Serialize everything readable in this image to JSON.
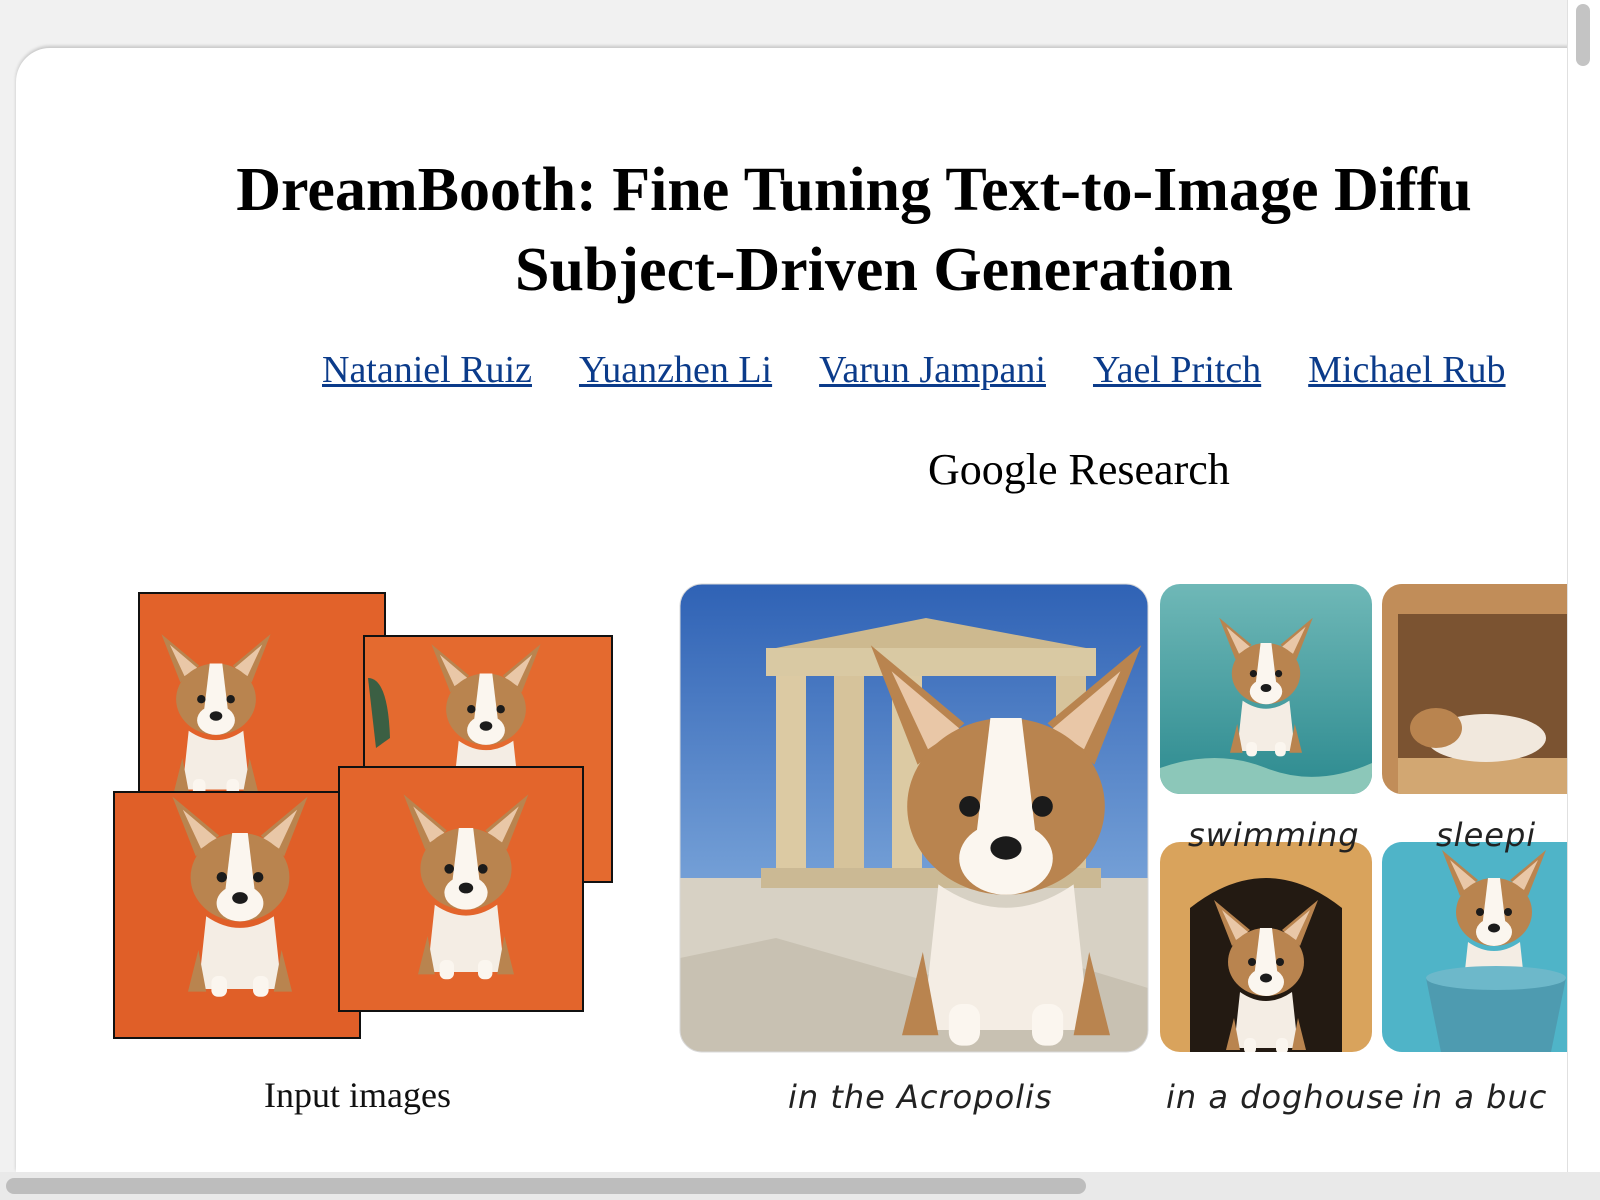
{
  "paper": {
    "title_line1": "DreamBooth: Fine Tuning Text-to-Image Diffu",
    "title_line2": "Subject-Driven Generation",
    "authors": [
      "Nataniel Ruiz",
      "Yuanzhen Li",
      "Varun Jampani",
      "Yael Pritch",
      "Michael Rub"
    ],
    "affiliation": "Google Research"
  },
  "figure": {
    "input_caption": "Input images",
    "captions": {
      "acropolis": "in the Acropolis",
      "swimming": "swimming",
      "sleeping": "sleepi",
      "doghouse": "in a doghouse",
      "bucket": "in a buc"
    }
  },
  "colors": {
    "link": "#0b3b8a",
    "orange_backdrop": "#e2622a",
    "corgi_tan": "#b9844f"
  }
}
